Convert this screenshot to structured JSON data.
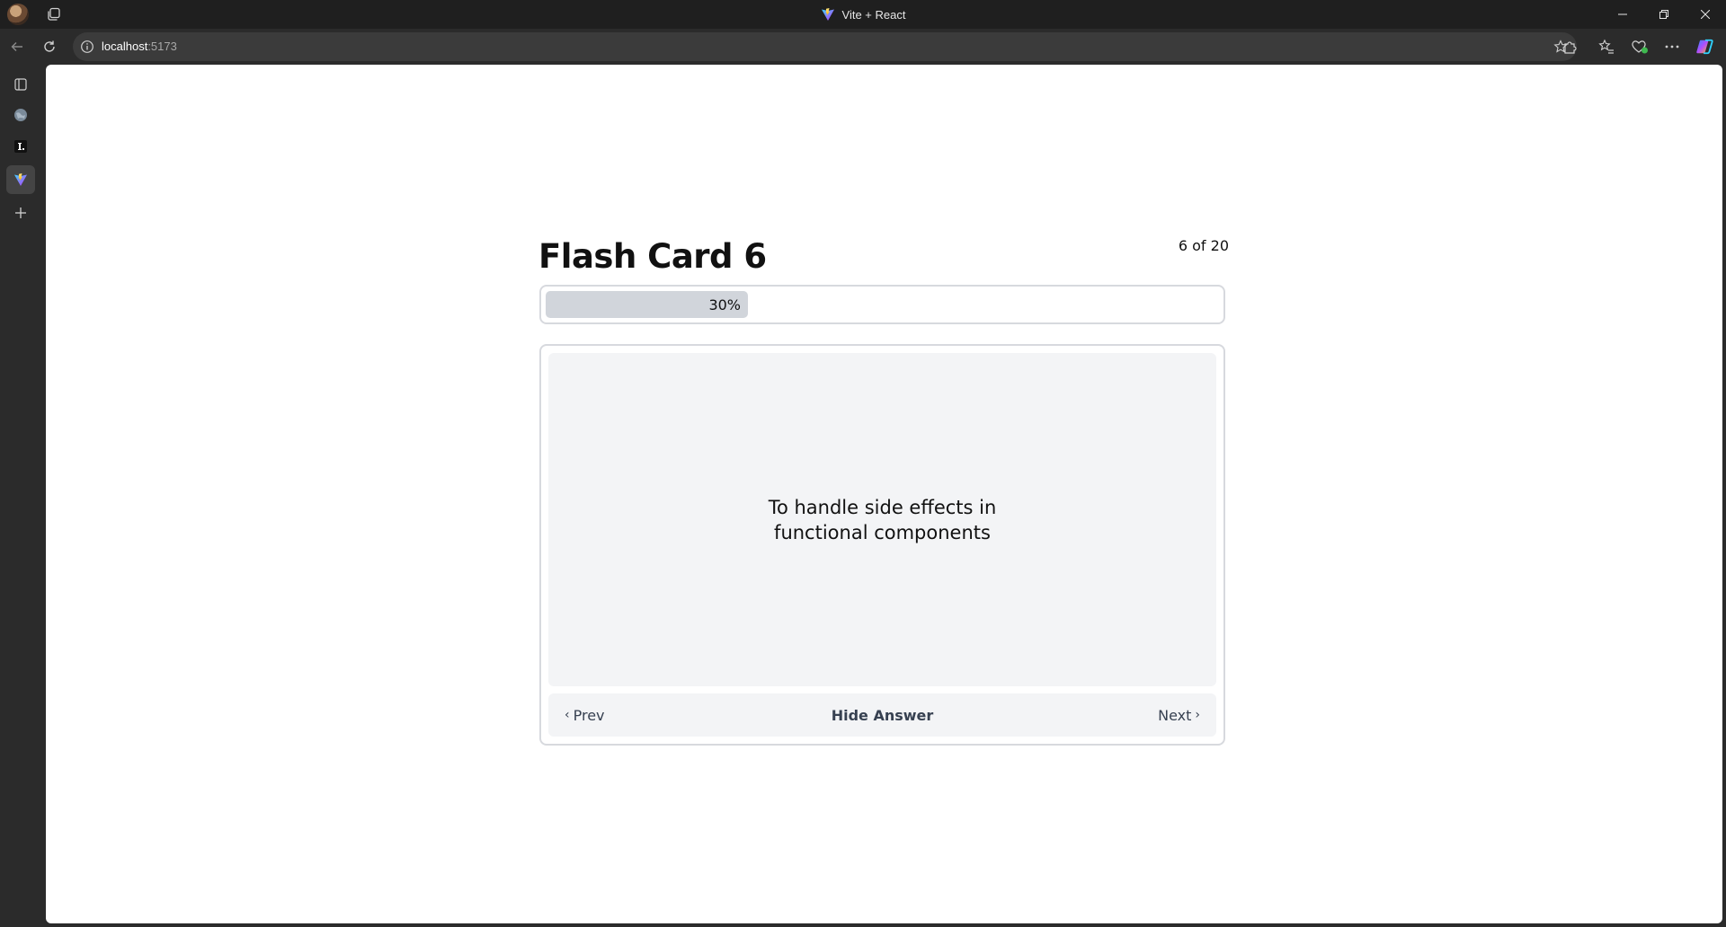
{
  "window": {
    "title": "Vite + React"
  },
  "address_bar": {
    "host": "localhost",
    "port": ":5173"
  },
  "page": {
    "title": "Flash Card 6",
    "counter": "6 of 20",
    "progress": {
      "percent": 30,
      "label": "30%"
    },
    "card": {
      "text": "To handle side effects in functional components"
    },
    "controls": {
      "prev_label": "Prev",
      "toggle_label": "Hide Answer",
      "next_label": "Next"
    }
  },
  "colors": {
    "titlebar_bg": "#1f1f1f",
    "chrome_bg": "#2b2b2b",
    "card_bg": "#f3f4f6",
    "progress_fill": "#d1d5db",
    "border": "#d7d9de"
  }
}
